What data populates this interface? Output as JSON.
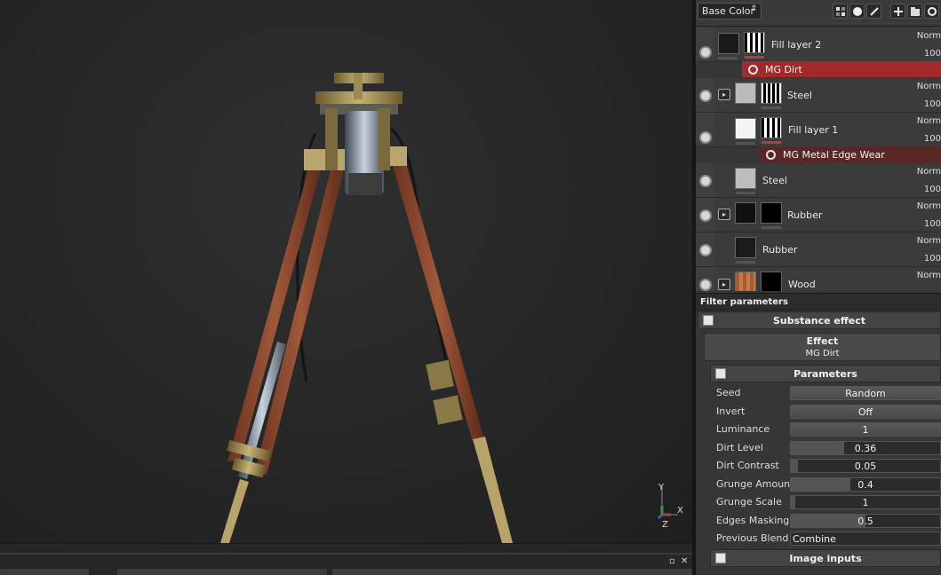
{
  "layers_panel": {
    "channel": "Base Color",
    "channel_arrows": "⇕",
    "toolbar_icons": [
      "mask-generator-icon",
      "material-sphere-icon",
      "paint-brush-icon",
      "add-layer-icon",
      "add-folder-icon",
      "clear-icon"
    ],
    "layers": [
      {
        "name": "Fill layer 2",
        "blend": "Norm",
        "opacity": "100"
      },
      {
        "name": "Steel",
        "blend": "Norm",
        "opacity": "100"
      },
      {
        "name": "Fill layer 1",
        "blend": "Norm",
        "opacity": "100"
      },
      {
        "name": "Steel",
        "blend": "Norm",
        "opacity": "100"
      },
      {
        "name": "Rubber",
        "blend": "Norm",
        "opacity": "100"
      },
      {
        "name": "Rubber",
        "blend": "Norm",
        "opacity": "100"
      },
      {
        "name": "Wood",
        "blend": "Norm",
        "opacity": "100"
      }
    ],
    "effects": [
      {
        "name": "MG Dirt",
        "color": "#a32a2a"
      },
      {
        "name": "MG Metal Edge Wear",
        "color": "#5a2626"
      }
    ]
  },
  "filter_parameters": {
    "header": "Filter parameters",
    "substance_effect_label": "Substance effect",
    "effect_title": "Effect",
    "effect_value": "MG Dirt",
    "parameters_label": "Parameters",
    "image_inputs_label": "Image inputs",
    "params": [
      {
        "label": "Seed",
        "value": "Random",
        "kind": "button"
      },
      {
        "label": "Invert",
        "value": "Off",
        "kind": "button"
      },
      {
        "label": "Luminance",
        "value": "1",
        "kind": "button"
      },
      {
        "label": "Dirt Level",
        "value": "0.36",
        "kind": "slider",
        "fill": 0.36
      },
      {
        "label": "Dirt Contrast",
        "value": "0.05",
        "kind": "slider",
        "fill": 0.05
      },
      {
        "label": "Grunge Amount",
        "value": "0.4",
        "kind": "slider",
        "fill": 0.4
      },
      {
        "label": "Grunge Scale",
        "value": "1",
        "kind": "slider",
        "fill": 0.0
      },
      {
        "label": "Edges Masking",
        "value": "0.5",
        "kind": "slider",
        "fill": 0.5
      },
      {
        "label": "Previous Blend",
        "value": "Combine",
        "kind": "select"
      }
    ]
  },
  "viewport": {
    "axis_labels": {
      "y": "Y",
      "x": "X",
      "z": "Z"
    }
  },
  "bottom_bar": {
    "controls": [
      "▫",
      "✕"
    ]
  },
  "colors": {
    "accent_effect": "#a32a2a",
    "panel_bg": "#363636",
    "viewport_bg": "#262626"
  }
}
